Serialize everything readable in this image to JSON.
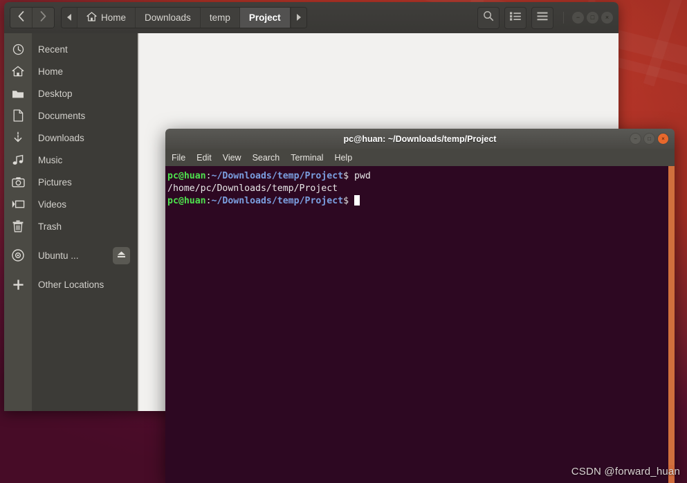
{
  "desktop": {
    "wallpaper_colors": [
      "#c0392b",
      "#8d2533",
      "#5b0f32"
    ],
    "watermark": "CSDN @forward_huan"
  },
  "file_manager": {
    "window_title": "Project",
    "nav": {
      "back_icon": "chevron-left-icon",
      "forward_icon": "chevron-right-icon"
    },
    "pathbar": {
      "scroll_left_icon": "triangle-left-icon",
      "scroll_right_icon": "triangle-right-icon",
      "crumbs": [
        {
          "label": "Home",
          "icon": "home-icon",
          "active": false
        },
        {
          "label": "Downloads",
          "icon": "",
          "active": false
        },
        {
          "label": "temp",
          "icon": "",
          "active": false
        },
        {
          "label": "Project",
          "icon": "",
          "active": true
        }
      ]
    },
    "toolbar": {
      "search_icon": "search-icon",
      "view_options_icon": "list-view-icon",
      "menu_icon": "hamburger-menu-icon"
    },
    "window_controls": {
      "minimize": "−",
      "maximize": "□",
      "close": "×"
    },
    "sidebar": {
      "items": [
        {
          "label": "Recent",
          "icon": "clock-icon"
        },
        {
          "label": "Home",
          "icon": "home-icon"
        },
        {
          "label": "Desktop",
          "icon": "folder-icon"
        },
        {
          "label": "Documents",
          "icon": "document-icon"
        },
        {
          "label": "Downloads",
          "icon": "download-arrow-icon"
        },
        {
          "label": "Music",
          "icon": "music-note-icon"
        },
        {
          "label": "Pictures",
          "icon": "camera-icon"
        },
        {
          "label": "Videos",
          "icon": "video-camera-icon"
        },
        {
          "label": "Trash",
          "icon": "trash-icon"
        }
      ],
      "devices": [
        {
          "label": "Ubuntu ...",
          "icon": "disc-icon",
          "eject_icon": "eject-icon"
        }
      ],
      "other": [
        {
          "label": "Other Locations",
          "icon": "plus-icon"
        }
      ]
    }
  },
  "terminal": {
    "title": "pc@huan: ~/Downloads/temp/Project",
    "window_controls": {
      "minimize": "−",
      "maximize": "□",
      "close": "×"
    },
    "menu": [
      "File",
      "Edit",
      "View",
      "Search",
      "Terminal",
      "Help"
    ],
    "prompt": {
      "user": "pc@huan",
      "colon": ":",
      "path": "~/Downloads/temp/Project",
      "dollar": "$"
    },
    "lines": [
      {
        "type": "prompt",
        "command": " pwd"
      },
      {
        "type": "output",
        "text": "/home/pc/Downloads/temp/Project"
      },
      {
        "type": "prompt_cursor",
        "command": " "
      }
    ],
    "colors": {
      "background": "#2d0822",
      "user": "#4ee24e",
      "path": "#7b9fe0",
      "text": "#e8e8e8",
      "scrollbar": "#cf6a3a"
    }
  }
}
